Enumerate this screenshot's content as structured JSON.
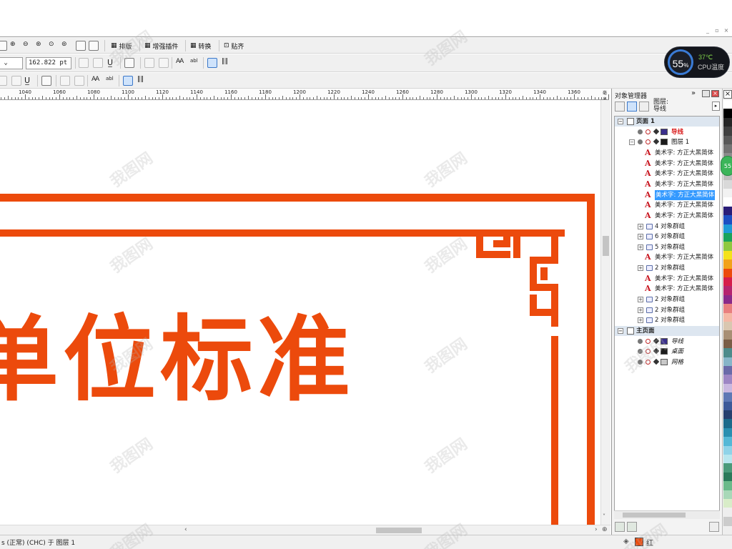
{
  "window": {
    "buttons": [
      "_",
      "▫",
      "×"
    ]
  },
  "toolbar1": {
    "menus": [
      {
        "label": "排版",
        "icon": "layout-icon"
      },
      {
        "label": "增强插件",
        "icon": "plugin-icon"
      },
      {
        "label": "转换",
        "icon": "convert-icon"
      },
      {
        "label": "贴齐",
        "icon": "snap-icon"
      }
    ]
  },
  "toolbar2": {
    "font_size_value": "162.822 pt"
  },
  "ruler": {
    "labels": [
      "1040",
      "1060",
      "1080",
      "1100",
      "1120",
      "1140",
      "1160",
      "1180",
      "1200",
      "1220",
      "1240",
      "1260",
      "1280",
      "1300",
      "1320",
      "1340",
      "1360"
    ],
    "unit_marker": "毫米"
  },
  "canvas": {
    "title_text": "单位标准",
    "accent_color": "#ec4a0c"
  },
  "status": {
    "text": "s (正常) (CHC) 于 图层 1",
    "fill_label": "红",
    "fill_color": "#ec4a0c"
  },
  "cpu_widget": {
    "percent": "55",
    "percent_unit": "%",
    "temperature": "37℃",
    "label": "CPU温度"
  },
  "object_manager": {
    "title": "对象管理器",
    "layer_caption": "图层:",
    "layer_current": "导线",
    "rows": [
      {
        "kind": "header",
        "label": "页面 1",
        "indent": 0
      },
      {
        "kind": "layer",
        "label": "导线",
        "indent": 1,
        "swatch": "#3a2f8c",
        "label_color": "#d91a1a",
        "italic": false
      },
      {
        "kind": "layer",
        "label": "图层 1",
        "indent": 1,
        "swatch": "#1c1c1c",
        "label_color": "#111",
        "italic": false,
        "expander": "−"
      },
      {
        "kind": "text",
        "label": "美术字: 方正大黑简体",
        "indent": 2
      },
      {
        "kind": "text",
        "label": "美术字: 方正大黑简体",
        "indent": 2
      },
      {
        "kind": "text",
        "label": "美术字: 方正大黑简体",
        "indent": 2
      },
      {
        "kind": "text",
        "label": "美术字: 方正大黑简体",
        "indent": 2
      },
      {
        "kind": "text",
        "label": "美术字: 方正大黑简体",
        "indent": 2,
        "selected": true
      },
      {
        "kind": "text",
        "label": "美术字: 方正大黑简体",
        "indent": 2
      },
      {
        "kind": "text",
        "label": "美术字: 方正大黑简体",
        "indent": 2
      },
      {
        "kind": "group",
        "label": "4 对象群组",
        "indent": 2
      },
      {
        "kind": "group",
        "label": "6 对象群组",
        "indent": 2
      },
      {
        "kind": "group",
        "label": "5 对象群组",
        "indent": 2
      },
      {
        "kind": "text",
        "label": "美术字: 方正大黑简体",
        "indent": 2
      },
      {
        "kind": "group",
        "label": "2 对象群组",
        "indent": 2
      },
      {
        "kind": "text",
        "label": "美术字: 方正大黑简体",
        "indent": 2
      },
      {
        "kind": "text",
        "label": "美术字: 方正大黑简体",
        "indent": 2
      },
      {
        "kind": "group",
        "label": "2 对象群组",
        "indent": 2
      },
      {
        "kind": "group",
        "label": "2 对象群组",
        "indent": 2
      },
      {
        "kind": "group",
        "label": "2 对象群组",
        "indent": 2
      },
      {
        "kind": "header",
        "label": "主页面",
        "indent": 0
      },
      {
        "kind": "layer",
        "label": "导线",
        "indent": 1,
        "swatch": "#3a2f8c",
        "label_color": "#111",
        "italic": true
      },
      {
        "kind": "layer",
        "label": "桌面",
        "indent": 1,
        "swatch": "#1c1c1c",
        "label_color": "#111",
        "italic": true
      },
      {
        "kind": "layer",
        "label": "网格",
        "indent": 1,
        "swatch": "#c8c8c8",
        "label_color": "#111",
        "italic": true
      }
    ]
  },
  "palette": {
    "colors": [
      "#ffffff",
      "#000000",
      "#262626",
      "#404040",
      "#595959",
      "#737373",
      "#8c8c8c",
      "#a6a6a6",
      "#bfbfbf",
      "#d9d9d9",
      "#f2f2f2",
      "#ffffff",
      "#2a1d78",
      "#1c4fc2",
      "#1f9ad6",
      "#19a35a",
      "#8ec83f",
      "#f4e21a",
      "#f2a21a",
      "#ec4a0c",
      "#d61d4b",
      "#b5246f",
      "#8a2a8a",
      "#e97f7f",
      "#f5b8a5",
      "#d9c7b0",
      "#a88f74",
      "#7a5d46",
      "#4d8a8a",
      "#87b5c8",
      "#6a6aa8",
      "#9d86c4",
      "#c9b8e0",
      "#5e79b5",
      "#3d5a99",
      "#26406e",
      "#1c6a8a",
      "#2a8fb0",
      "#55b8d6",
      "#8fd3e8",
      "#b8e6ee",
      "#4a9a7a",
      "#2a7a5a",
      "#6aba8a",
      "#a8d8b8",
      "#d8ecc8",
      "#eeeeee",
      "#cccccc"
    ]
  },
  "watermarks": [
    "我图网",
    "我图网",
    "我图网",
    "我图网",
    "我图网",
    "我图网",
    "我图网",
    "我图网",
    "我图网",
    "我图网",
    "我图网",
    "我图网",
    "我图网",
    "我图网"
  ]
}
